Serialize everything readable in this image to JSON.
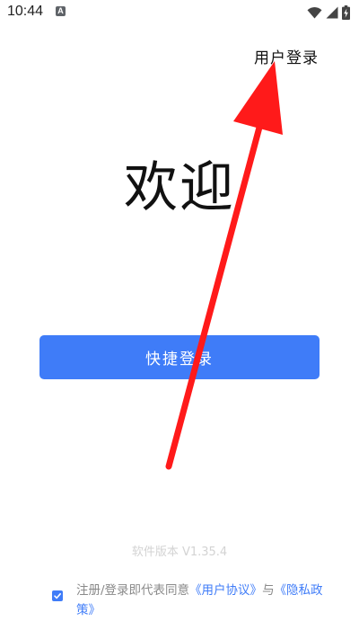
{
  "status_bar": {
    "time": "10:44",
    "notification_glyph": "A",
    "icons": [
      "wifi-icon",
      "cell-signal-icon",
      "battery-charging-icon"
    ]
  },
  "header": {
    "login_link": "用户登录"
  },
  "main": {
    "welcome": "欢迎",
    "quick_login_label": "快捷登录"
  },
  "footer": {
    "version": "软件版本 V1.35.4",
    "agreement": {
      "checked": true,
      "prefix": "注册/登录即代表同意",
      "user_agreement": "《用户协议》",
      "conjunction": "与",
      "privacy_policy": "《隐私政策》"
    }
  },
  "colors": {
    "accent": "#3f7cf8",
    "annotation_arrow": "#ff1a1a"
  }
}
